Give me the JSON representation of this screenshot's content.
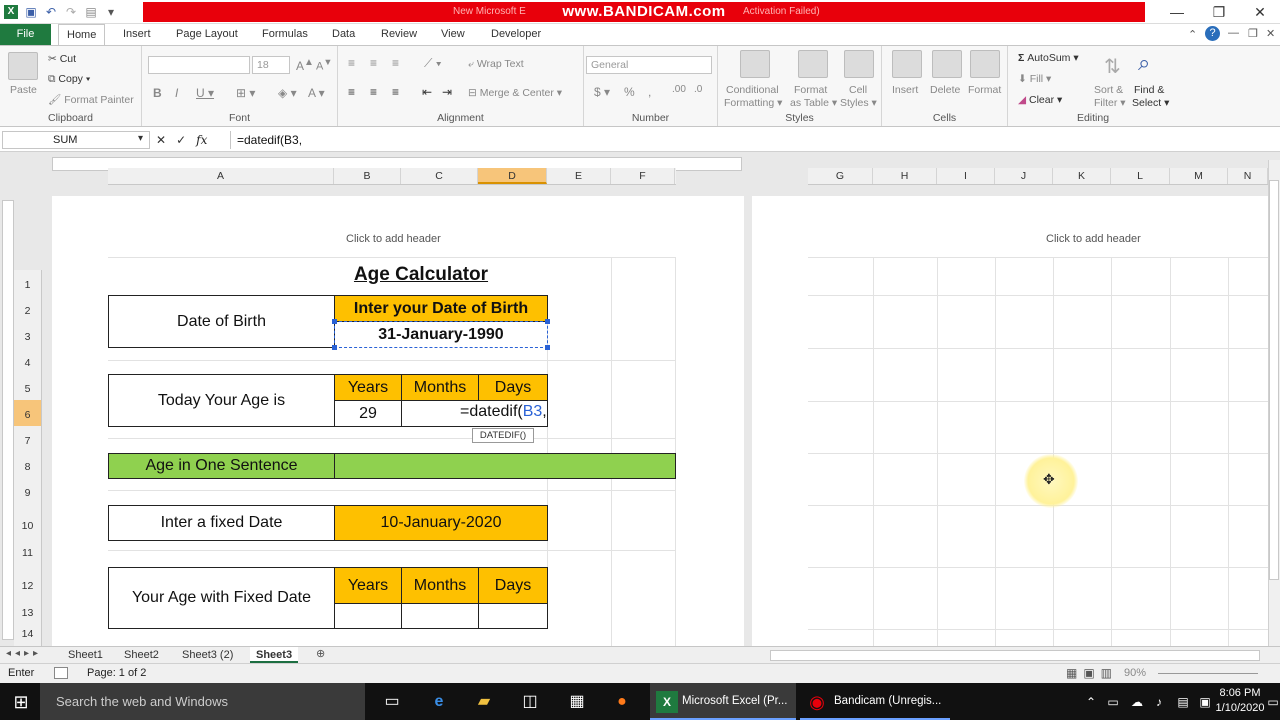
{
  "titlebar": {
    "watermark": "www.BANDICAM.com",
    "title_left": "New Microsoft E",
    "title_right": "Activation Failed)"
  },
  "tabs": [
    "File",
    "Home",
    "Insert",
    "Page Layout",
    "Formulas",
    "Data",
    "Review",
    "View",
    "Developer"
  ],
  "ribbon": {
    "clipboard": {
      "paste": "Paste",
      "cut": "Cut",
      "copy": "Copy",
      "format_painter": "Format Painter",
      "label": "Clipboard"
    },
    "font": {
      "size": "18",
      "label": "Font"
    },
    "alignment": {
      "wrap": "Wrap Text",
      "merge": "Merge & Center",
      "label": "Alignment"
    },
    "number": {
      "format": "General",
      "label": "Number"
    },
    "styles": {
      "conditional": "Conditional",
      "formatting": "Formatting",
      "format_as": "Format",
      "as_table": "as Table",
      "cell": "Cell",
      "styles_word": "Styles",
      "label": "Styles"
    },
    "cells": {
      "insert": "Insert",
      "delete": "Delete",
      "format": "Format",
      "label": "Cells"
    },
    "editing": {
      "autosum": "AutoSum",
      "fill": "Fill",
      "clear": "Clear",
      "sort": "Sort &",
      "filter": "Filter",
      "find": "Find &",
      "select": "Select",
      "label": "Editing"
    }
  },
  "formula_bar": {
    "name_box": "SUM",
    "formula": "=datedif(B3,"
  },
  "columns_left": [
    "A",
    "B",
    "C",
    "D",
    "E",
    "F"
  ],
  "columns_right": [
    "G",
    "H",
    "I",
    "J",
    "K",
    "L",
    "M",
    "N"
  ],
  "rows": [
    "1",
    "2",
    "3",
    "4",
    "5",
    "6",
    "7",
    "8",
    "9",
    "10",
    "11",
    "12",
    "13",
    "14"
  ],
  "page": {
    "header_hint": "Click to add header"
  },
  "sheet": {
    "title": "Age Calculator",
    "dob_label": "Date of Birth",
    "dob_prompt": "Inter your Date of Birth",
    "dob_value": "31-January-1990",
    "today_label": "Today Your Age is",
    "years": "Years",
    "months": "Months",
    "days": "Days",
    "years_value": "29",
    "editing_formula_prefix": "=datedif(",
    "editing_formula_ref": "B3",
    "editing_formula_suffix": ",",
    "tooltip": "DATEDIF()",
    "sentence_label": "Age in One Sentence",
    "fixed_label": "Inter a fixed Date",
    "fixed_value": "10-January-2020",
    "fixed_age_label": "Your Age with Fixed Date"
  },
  "sheet_tabs": [
    "Sheet1",
    "Sheet2",
    "Sheet3 (2)",
    "Sheet3"
  ],
  "status": {
    "mode": "Enter",
    "page": "Page: 1 of 2",
    "zoom": "90%"
  },
  "taskbar": {
    "search": "Search the web and Windows",
    "excel": "Microsoft Excel (Pr...",
    "bandicam": "Bandicam (Unregis...",
    "time": "8:06 PM",
    "date": "1/10/2020"
  },
  "colors": {
    "orange": "#fec000",
    "green": "#8fd14f",
    "excel_green": "#1f7a3f",
    "bandicam_red": "#e8000b"
  }
}
